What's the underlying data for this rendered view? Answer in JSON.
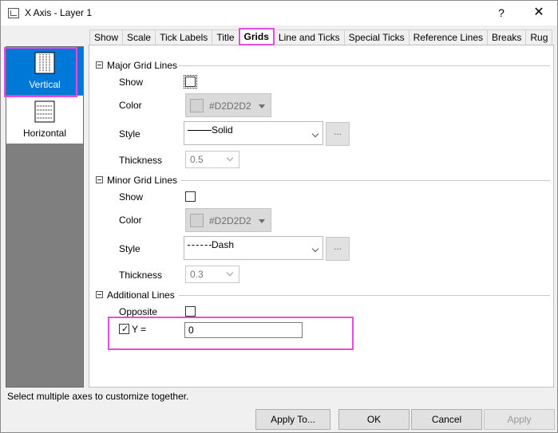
{
  "window": {
    "title": "X Axis - Layer 1",
    "help_label": "?",
    "close_label": "✕"
  },
  "axes": [
    {
      "label": "Vertical",
      "selected": true
    },
    {
      "label": "Horizontal",
      "selected": false
    }
  ],
  "tabs": [
    {
      "label": "Show"
    },
    {
      "label": "Scale"
    },
    {
      "label": "Tick Labels"
    },
    {
      "label": "Title"
    },
    {
      "label": "Grids",
      "active": true
    },
    {
      "label": "Line and Ticks"
    },
    {
      "label": "Special Ticks"
    },
    {
      "label": "Reference Lines"
    },
    {
      "label": "Breaks"
    },
    {
      "label": "Rug"
    }
  ],
  "major": {
    "heading": "Major Grid Lines",
    "show_label": "Show",
    "show_checked": false,
    "color_label": "Color",
    "color_value": "#D2D2D2",
    "style_label": "Style",
    "style_value": "Solid",
    "thickness_label": "Thickness",
    "thickness_value": "0.5"
  },
  "minor": {
    "heading": "Minor Grid Lines",
    "show_label": "Show",
    "show_checked": false,
    "color_label": "Color",
    "color_value": "#D2D2D2",
    "style_label": "Style",
    "style_value": "Dash",
    "thickness_label": "Thickness",
    "thickness_value": "0.3"
  },
  "additional": {
    "heading": "Additional Lines",
    "opposite_label": "Opposite",
    "opposite_checked": false,
    "y_label": "Y =",
    "y_checked": true,
    "y_value": "0"
  },
  "more_label": "...",
  "status_text": "Select multiple axes to customize together.",
  "buttons": {
    "apply_to": "Apply To...",
    "ok": "OK",
    "cancel": "Cancel",
    "apply": "Apply"
  },
  "colors": {
    "highlight": "#e54dde",
    "selection": "#0078d7",
    "grid_color": "#D2D2D2"
  }
}
